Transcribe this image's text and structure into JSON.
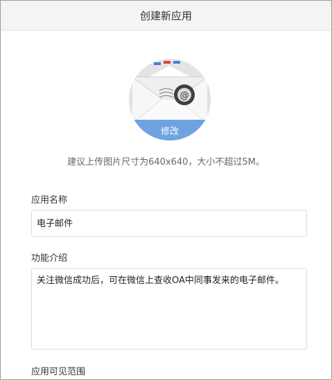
{
  "header": {
    "title": "创建新应用"
  },
  "avatar": {
    "edit_label": "修改",
    "icon": "mail-envelope-icon"
  },
  "hint": "建议上传图片尺寸为640x640，大小不超过5M。",
  "form": {
    "name": {
      "label": "应用名称",
      "value": "电子邮件"
    },
    "description": {
      "label": "功能介绍",
      "value": "关注微信成功后，可在微信上查收OA中同事发来的电子邮件。"
    },
    "scope": {
      "label": "应用可见范围"
    }
  },
  "colors": {
    "accent": "#6ea3e0",
    "header_bg": "#f4f4f4",
    "border": "#dcdcdc"
  }
}
